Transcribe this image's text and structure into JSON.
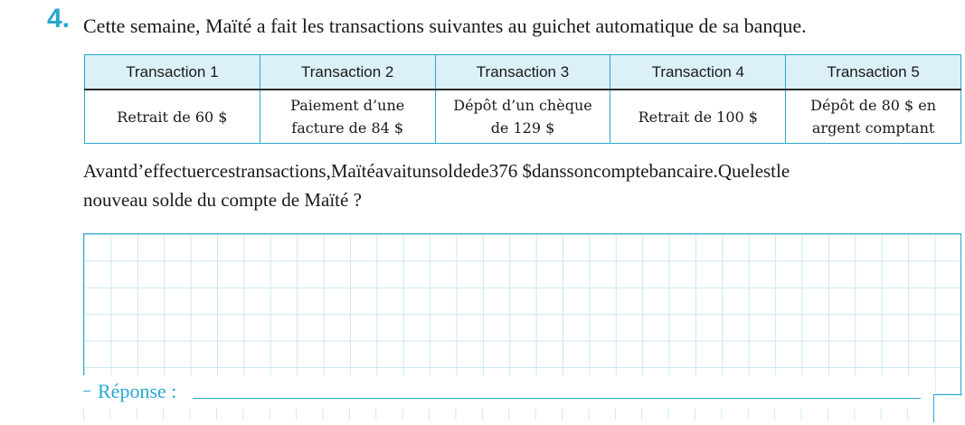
{
  "question": {
    "number": "4.",
    "intro": "Cette semaine, Maïté a fait les transactions suivantes au guichet automatique de sa banque."
  },
  "table": {
    "headers": [
      "Transaction 1",
      "Transaction 2",
      "Transaction 3",
      "Transaction 4",
      "Transaction 5"
    ],
    "cells": [
      [
        "Retrait de 60 $"
      ],
      [
        "Paiement d’une",
        "facture de 84 $"
      ],
      [
        "Dépôt d’un chèque",
        "de 129 $"
      ],
      [
        "Retrait de 100 $"
      ],
      [
        "Dépôt de 80 $ en",
        "argent comptant"
      ]
    ]
  },
  "paragraph": {
    "line1": "Avantd’effectuercestransactions,Maïtéavaitunsoldede376 $danssoncomptebancaire.Quelestle",
    "line2": "nouveau solde du compte de Maïté ?"
  },
  "answer": {
    "label": "Réponse :"
  },
  "colors": {
    "accent": "#29a8cf",
    "header_bg": "#dcf0f8",
    "grid": "#c9e8f3"
  }
}
